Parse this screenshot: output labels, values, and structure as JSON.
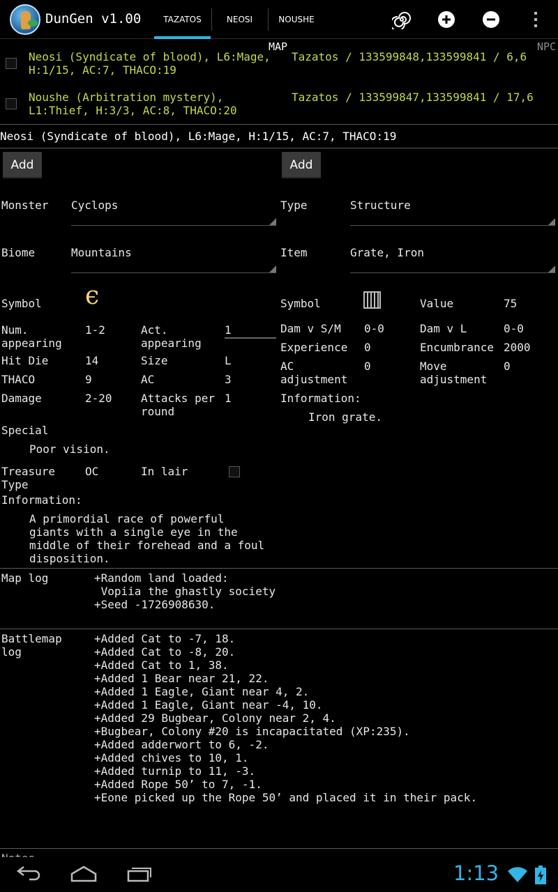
{
  "app": {
    "title": "DunGen v1.00",
    "tabs": [
      "TAZATOS",
      "NEOSI",
      "NOUSHE"
    ],
    "accent_color": "#33b5e5",
    "actions": [
      "spiral-icon",
      "add-icon",
      "remove-icon",
      "overflow-icon"
    ]
  },
  "header": {
    "map": "MAP",
    "npc": "NPC"
  },
  "party": [
    {
      "line1": "Neosi (Syndicate of blood), L6:Mage,",
      "loc": "Tazatos / 133599848,133599841 / 6,6",
      "line2": "H:1/15, AC:7, THACO:19"
    },
    {
      "line1": "Noushe (Arbitration mystery),",
      "loc": "Tazatos / 133599847,133599841 / 17,6",
      "line2": "L1:Thief, H:3/3, AC:8, THACO:20"
    }
  ],
  "selected_character": "Neosi (Syndicate of blood), L6:Mage, H:1/15, AC:7, THACO:19",
  "monster": {
    "add_label": "Add",
    "monster_label": "Monster",
    "monster_value": "Cyclops",
    "biome_label": "Biome",
    "biome_value": "Mountains",
    "symbol_label": "Symbol",
    "num_label": "Num.\nappearing",
    "num_value": "1-2",
    "act_label": "Act.\nappearing",
    "act_value": "1",
    "hitdie_label": "Hit Die",
    "hitdie_value": "14",
    "size_label": "Size",
    "size_value": "L",
    "thaco_label": "THACO",
    "thaco_value": "9",
    "ac_label": "AC",
    "ac_value": "3",
    "damage_label": "Damage",
    "damage_value": "2-20",
    "attacks_label": "Attacks per\nround",
    "attacks_value": "1",
    "special_label": "Special",
    "special_value": "Poor vision.",
    "treasure_label": "Treasure\nType",
    "treasure_value": "OC",
    "lair_label": "In lair",
    "info_label": "Information:",
    "info_value": "A primordial race of powerful\ngiants with a single eye in the\nmiddle of their forehead and a foul\ndisposition."
  },
  "item": {
    "add_label": "Add",
    "type_label": "Type",
    "type_value": "Structure",
    "item_label": "Item",
    "item_value": "Grate, Iron",
    "symbol_label": "Symbol",
    "value_label": "Value",
    "value_value": "75",
    "dam_sm_label": "Dam v S/M",
    "dam_sm_value": "0-0",
    "dam_l_label": "Dam v L",
    "dam_l_value": "0-0",
    "xp_label": "Experience",
    "xp_value": "0",
    "enc_label": "Encumbrance",
    "enc_value": "2000",
    "acadj_label": "AC\nadjustment",
    "acadj_value": "0",
    "move_label": "Move\nadjustment",
    "move_value": "0",
    "info_label": "Information:",
    "info_value": "Iron grate."
  },
  "maplog": {
    "label": "Map log",
    "text": "+Random land loaded:\n Vopiia the ghastly society\n+Seed -1726908630."
  },
  "battlelog": {
    "label": "Battlemap\nlog",
    "text": "+Added Cat to -7, 18.\n+Added Cat to -8, 20.\n+Added Cat to 1, 38.\n+Added 1 Bear near 21, 22.\n+Added 1 Eagle, Giant near 4, 2.\n+Added 1 Eagle, Giant near -4, 10.\n+Added 29 Bugbear, Colony near 2, 4.\n+Bugbear, Colony #20 is incapacitated (XP:235).\n+Added adderwort to 6, -2.\n+Added chives to 10, 1.\n+Added turnip to 11, -3.\n+Added Rope 50’ to 7, -1.\n+Eone picked up the Rope 50’ and placed it in their pack."
  },
  "notes_label": "Notes",
  "status": {
    "clock": "1:13"
  }
}
